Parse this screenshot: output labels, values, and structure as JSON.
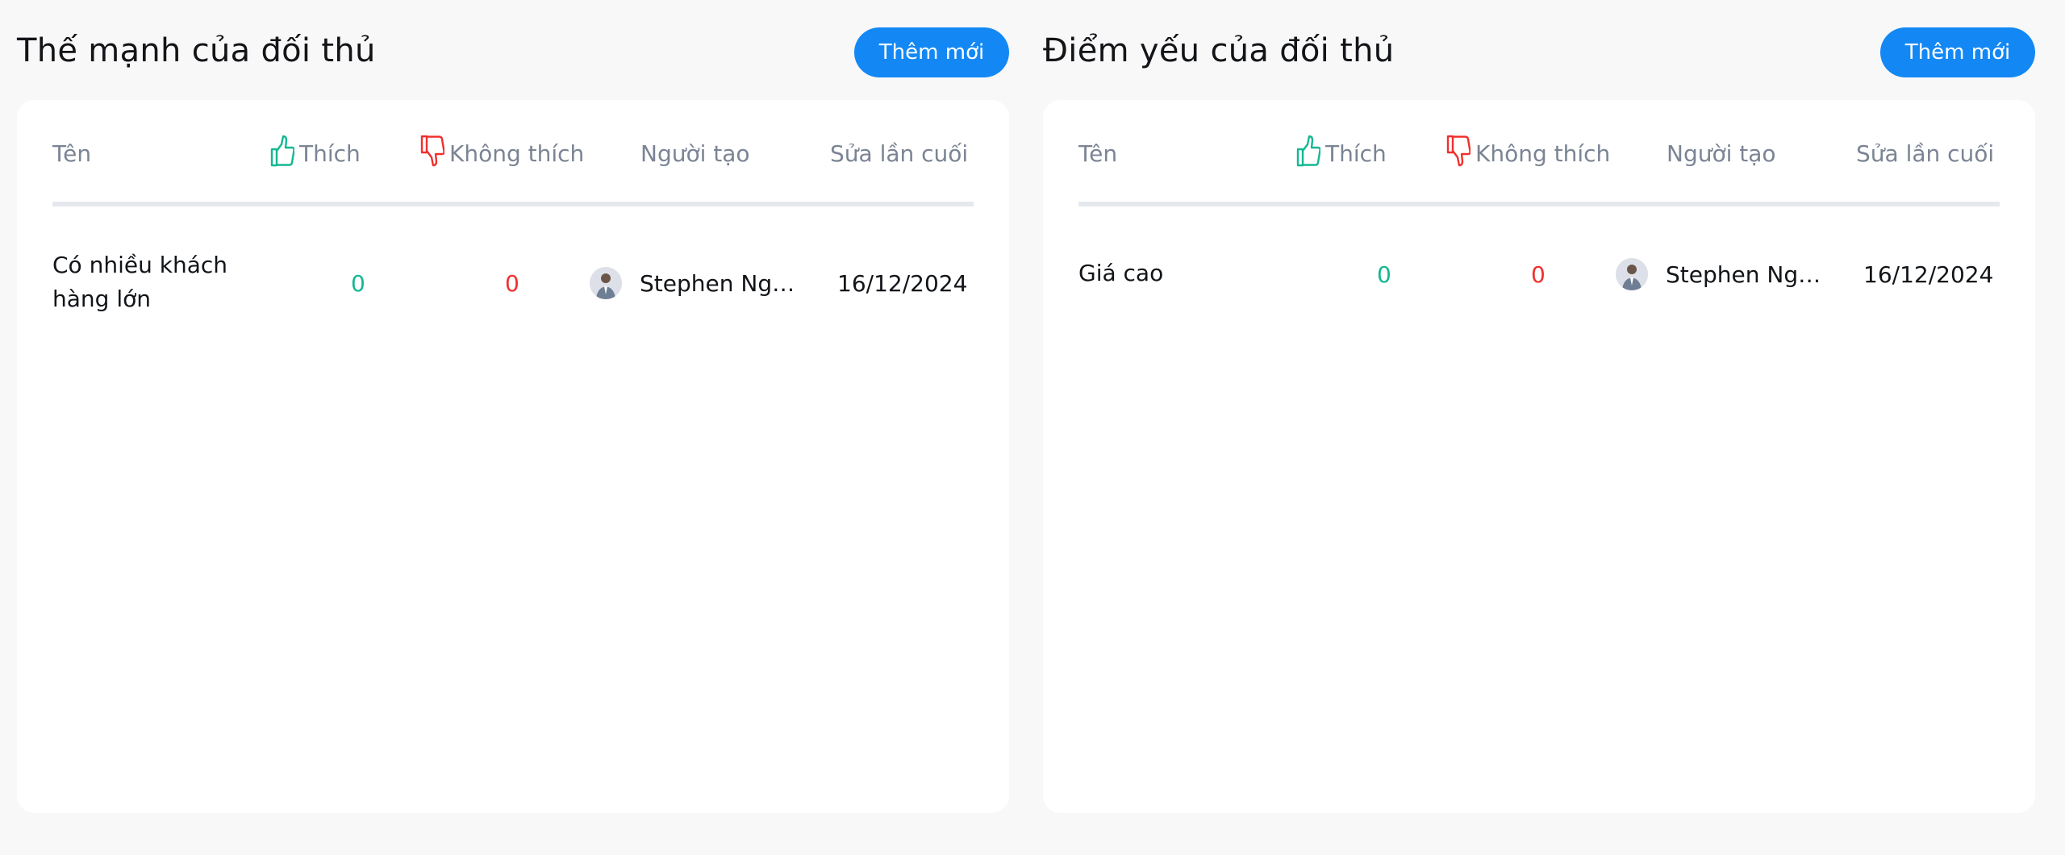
{
  "strengths": {
    "title": "Thế mạnh của đối thủ",
    "add_label": "Thêm mới",
    "columns": {
      "name": "Tên",
      "like": "Thích",
      "dislike": "Không thích",
      "creator": "Người tạo",
      "modified": "Sửa lần cuối"
    },
    "rows": [
      {
        "name": "Có nhiều khách hàng lớn",
        "likes": "0",
        "dislikes": "0",
        "creator": "Stephen Ngu...",
        "modified": "16/12/2024"
      }
    ]
  },
  "weaknesses": {
    "title": "Điểm yếu của đối thủ",
    "add_label": "Thêm mới",
    "columns": {
      "name": "Tên",
      "like": "Thích",
      "dislike": "Không thích",
      "creator": "Người tạo",
      "modified": "Sửa lần cuối"
    },
    "rows": [
      {
        "name": "Giá cao",
        "likes": "0",
        "dislikes": "0",
        "creator": "Stephen Ngu...",
        "modified": "16/12/2024"
      }
    ]
  },
  "icons": {
    "like": "thumbs-up-icon",
    "dislike": "thumbs-down-icon"
  },
  "colors": {
    "accent": "#1388f5",
    "like": "#14b892",
    "dislike": "#f0302e",
    "header_text": "#7b8494",
    "divider": "#e5e9ee"
  }
}
